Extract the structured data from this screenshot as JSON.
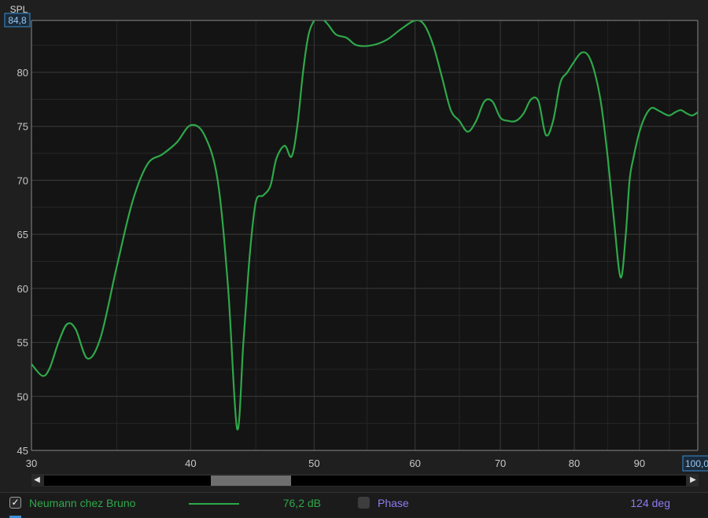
{
  "chart_data": {
    "type": "line",
    "ylabel": "SPL",
    "xlim": [
      30,
      100
    ],
    "ylim": [
      45,
      84.8
    ],
    "x_scale": "log",
    "y_ticks": [
      45,
      50,
      55,
      60,
      65,
      70,
      75,
      80
    ],
    "x_ticks": [
      30,
      40,
      50,
      60,
      70,
      80,
      90
    ],
    "y_max_label": "84,8",
    "x_max_label": "100,0",
    "grid": true,
    "series": [
      {
        "name": "Neumann chez Bruno",
        "color": "#2ea84a",
        "x": [
          30,
          30.6,
          31,
          31.5,
          32,
          32.5,
          33.2,
          34,
          35,
          36,
          37,
          38,
          39,
          40,
          41,
          42,
          42.8,
          43.5,
          44,
          44.5,
          45,
          45.6,
          46.2,
          46.7,
          47.4,
          48,
          48.5,
          49,
          49.5,
          50,
          50.4,
          51.2,
          52,
          53,
          54,
          55.5,
          57,
          58.5,
          60,
          61,
          62,
          63,
          64,
          65,
          66,
          67,
          68,
          69,
          70,
          71,
          72,
          73,
          74,
          75,
          76,
          77,
          78,
          79,
          80,
          81,
          82,
          83,
          84,
          85,
          86,
          87,
          87.8,
          88.4,
          89,
          90,
          91,
          92,
          93,
          94,
          95,
          96,
          97,
          98,
          99,
          100
        ],
        "values": [
          53.0,
          51.9,
          52.6,
          55.0,
          56.7,
          56.2,
          53.5,
          55.5,
          62.0,
          68.0,
          71.5,
          72.4,
          73.5,
          75.1,
          74.2,
          70.0,
          60.0,
          47.0,
          55.0,
          63.0,
          68.0,
          68.6,
          69.5,
          72.0,
          73.2,
          72.2,
          75.0,
          80.0,
          83.5,
          84.8,
          85.2,
          84.5,
          83.5,
          83.2,
          82.5,
          82.5,
          83.0,
          84.0,
          84.8,
          84.4,
          82.5,
          79.5,
          76.5,
          75.5,
          74.5,
          75.5,
          77.3,
          77.3,
          75.8,
          75.5,
          75.5,
          76.2,
          77.5,
          77.3,
          74.2,
          75.5,
          79.0,
          80.0,
          81.0,
          81.8,
          81.6,
          80.0,
          77.0,
          72.0,
          66.0,
          61.0,
          65.0,
          70.0,
          72.0,
          74.5,
          76.0,
          76.7,
          76.5,
          76.2,
          76.0,
          76.3,
          76.5,
          76.2,
          76.0,
          76.3
        ]
      }
    ]
  },
  "legend": {
    "series_name": "Neumann chez Bruno",
    "series_value": "76,2 dB",
    "phase_label": "Phase",
    "phase_value": "124 deg"
  },
  "colors": {
    "series": "#2ea84a",
    "phase": "#8c7cf0",
    "highlight_box": "#3a8fd6"
  },
  "icons": {
    "checkbox": "check-icon",
    "scroll_left": "arrow-left-icon",
    "scroll_right": "arrow-right-icon"
  }
}
